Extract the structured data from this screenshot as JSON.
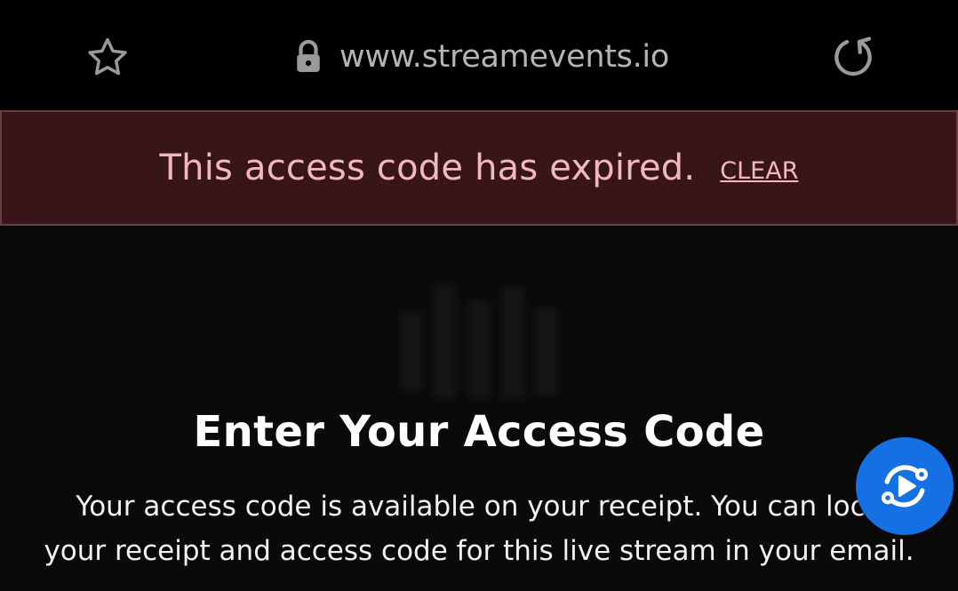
{
  "browser": {
    "url": "www.streamevents.io",
    "icons": [
      "star-icon",
      "lock-icon",
      "reload-icon"
    ]
  },
  "alert": {
    "message": "This access code has expired.",
    "clear_label": "CLEAR"
  },
  "main": {
    "title": "Enter Your Access Code",
    "description_line1": "Your access code is available on your receipt. You can loca",
    "description_line2": "your receipt and access code for this live stream in your email."
  },
  "floating_button": {
    "icon": "stream-play-icon"
  },
  "colors": {
    "alert_background": "#381519",
    "alert_text": "#f3b7be",
    "fab_blue": "#1570e3"
  }
}
